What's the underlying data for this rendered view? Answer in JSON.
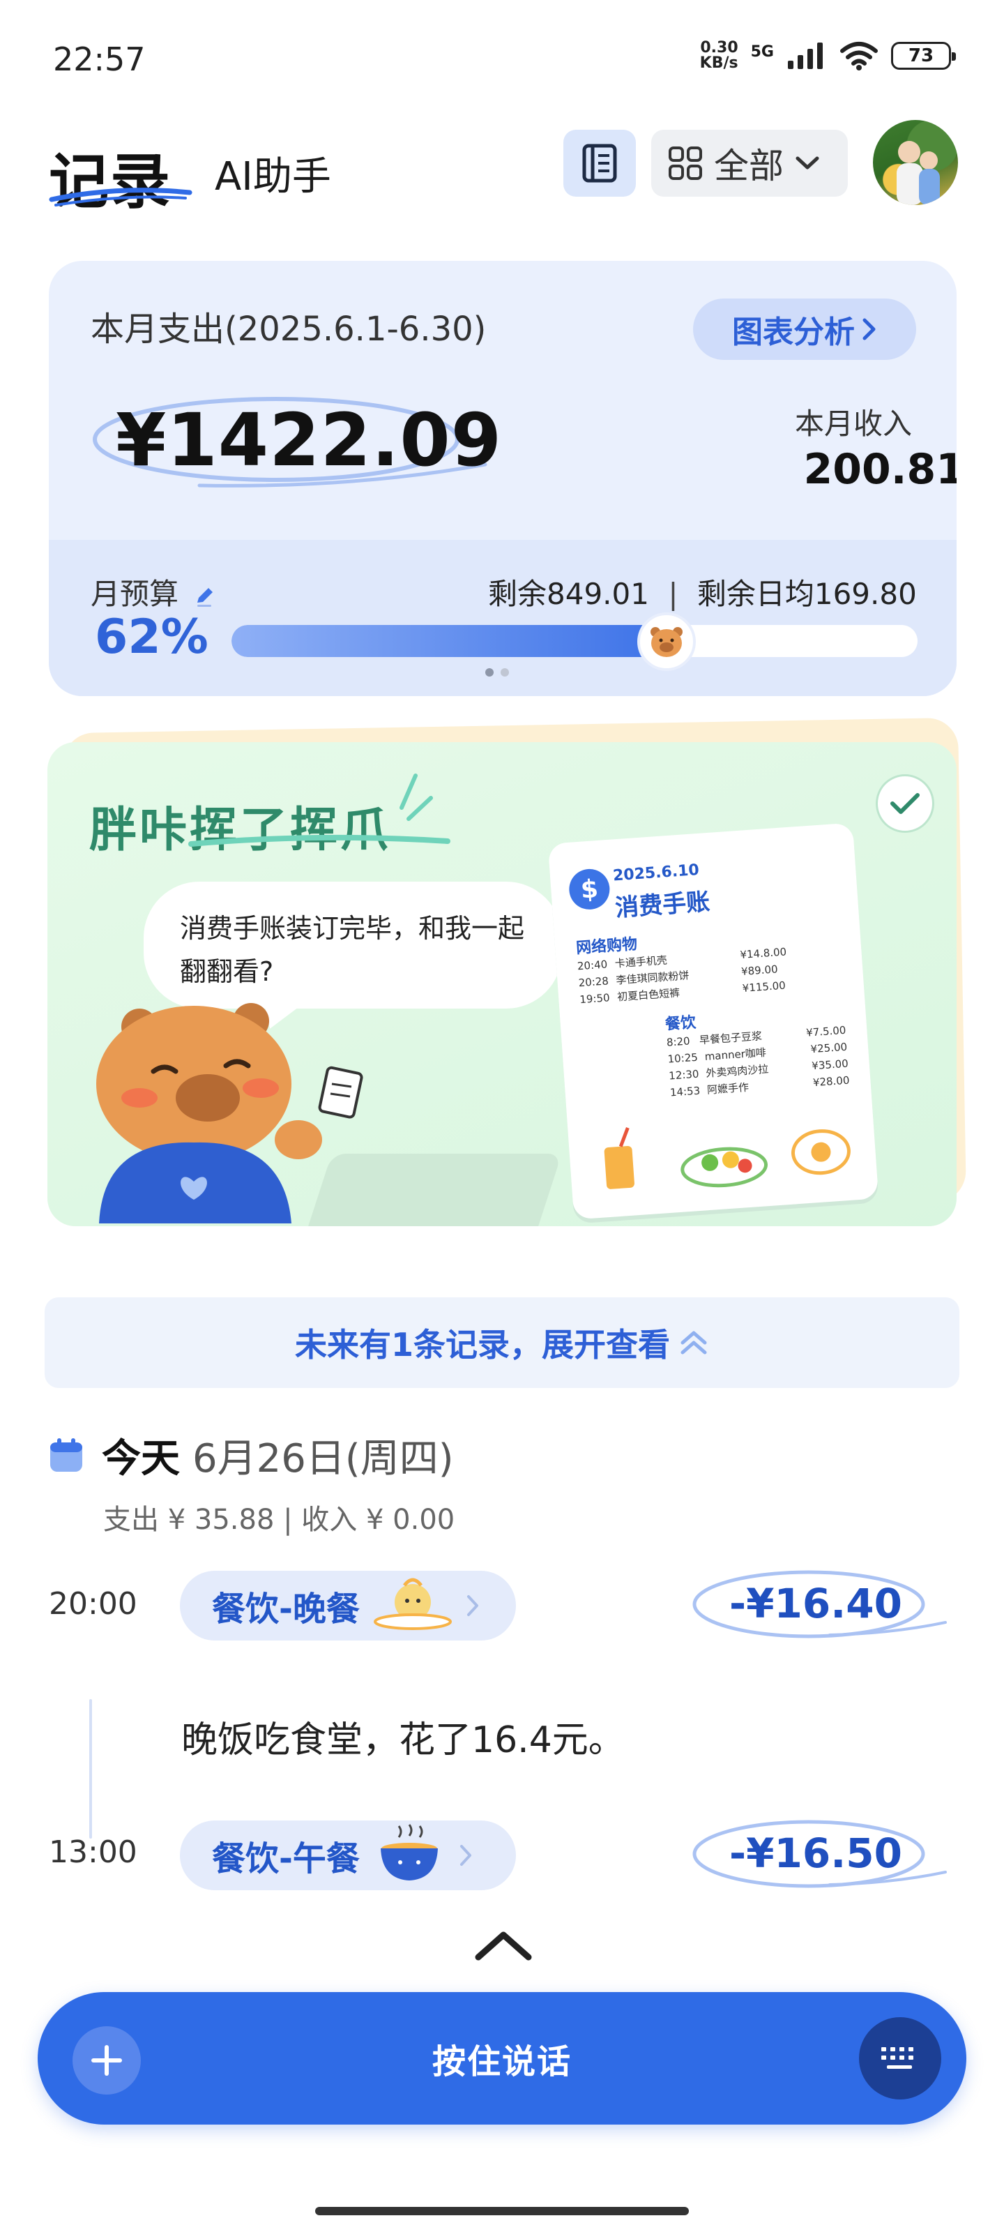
{
  "status_bar": {
    "time": "22:57",
    "net_speed_value": "0.30",
    "net_speed_unit": "KB/s",
    "signal_type": "5G",
    "battery": "73"
  },
  "header": {
    "tab_records": "记录",
    "tab_ai": "AI助手",
    "filter_label": "全部"
  },
  "summary": {
    "month_label": "本月支出(2025.6.1-6.30)",
    "chart_button": "图表分析",
    "expense": "¥1422.09",
    "income_label": "本月收入",
    "income_value": "200.81",
    "budget_label": "月预算",
    "budget_percent": "62%",
    "budget_fraction": 0.62,
    "remaining": "剩余849.01",
    "remaining_daily": "剩余日均169.80",
    "separator": "|"
  },
  "promo": {
    "title": "胖咔挥了挥爪",
    "bubble_text": "消费手账装订完毕，和我一起翻翻看?",
    "receipt": {
      "date": "2025.6.10",
      "title": "消费手账",
      "section_shopping": "网络购物",
      "shopping_rows": [
        {
          "time": "20:40",
          "name": "卡通手机壳",
          "amount": "¥14.8.00"
        },
        {
          "time": "20:28",
          "name": "李佳琪同款粉饼",
          "amount": "¥89.00"
        },
        {
          "time": "19:50",
          "name": "初夏白色短裤",
          "amount": "¥115.00"
        }
      ],
      "section_food": "餐饮",
      "food_rows": [
        {
          "time": "8:20",
          "name": "早餐包子豆浆",
          "amount": "¥7.5.00"
        },
        {
          "time": "10:25",
          "name": "manner咖啡",
          "amount": "¥25.00"
        },
        {
          "time": "12:30",
          "name": "外卖鸡肉沙拉",
          "amount": "¥35.00"
        },
        {
          "time": "14:53",
          "name": "阿嬷手作",
          "amount": "¥28.00"
        }
      ]
    }
  },
  "future_notice": "未来有1条记录，展开查看",
  "day": {
    "today": "今天",
    "date": "6月26日(周四)",
    "summary": "支出 ¥ 35.88  |  收入 ¥ 0.00"
  },
  "entries": [
    {
      "time": "20:00",
      "category": "餐饮-晚餐",
      "amount": "-¥16.40",
      "note": "晚饭吃食堂，花了16.4元。"
    },
    {
      "time": "13:00",
      "category": "餐饮-午餐",
      "amount": "-¥16.50"
    }
  ],
  "voice_button": "按住说话",
  "icons": [
    "book-icon",
    "grid-icon",
    "chevron-down-icon",
    "chevron-right-icon",
    "edit-icon",
    "check-icon",
    "calendar-icon",
    "double-chevron-up-icon",
    "plus-icon",
    "keyboard-icon",
    "wifi-icon",
    "signal-icon"
  ],
  "colors": {
    "accent": "#2f6be6",
    "card_bg": "#eaf0fd",
    "promo_bg": "#e1f8e6",
    "promo_title": "#2f8a6a"
  }
}
